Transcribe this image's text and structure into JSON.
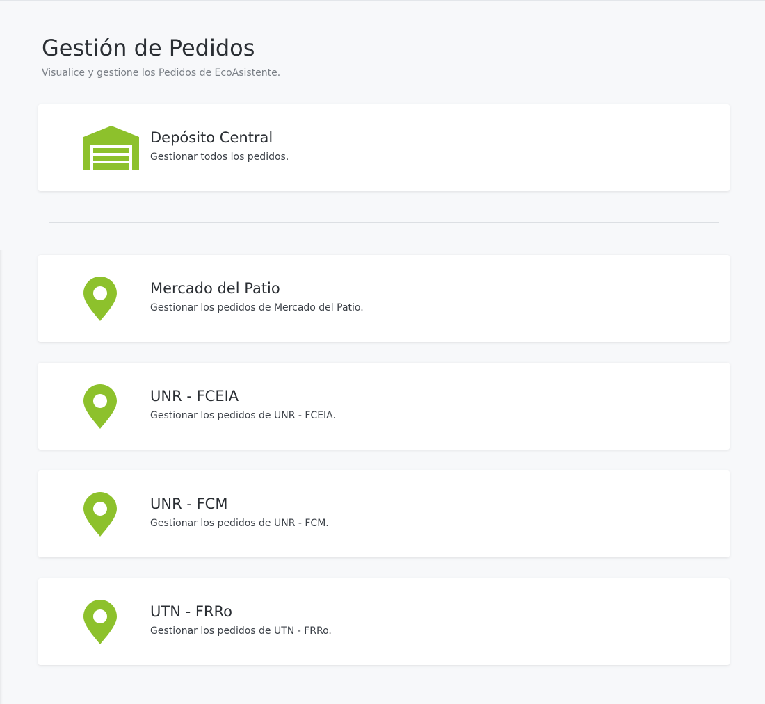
{
  "page": {
    "title": "Gestión de Pedidos",
    "subtitle": "Visualice y gestione los Pedidos de EcoAsistente."
  },
  "colors": {
    "accent": "#8dc12c",
    "background": "#f7f8fa",
    "card": "#ffffff"
  },
  "central": {
    "icon": "warehouse-icon",
    "title": "Depósito Central",
    "description": "Gestionar todos los pedidos."
  },
  "locations": [
    {
      "icon": "map-marker-icon",
      "title": "Mercado del Patio",
      "description": "Gestionar los pedidos de Mercado del Patio."
    },
    {
      "icon": "map-marker-icon",
      "title": "UNR - FCEIA",
      "description": "Gestionar los pedidos de UNR - FCEIA."
    },
    {
      "icon": "map-marker-icon",
      "title": "UNR - FCM",
      "description": "Gestionar los pedidos de UNR - FCM."
    },
    {
      "icon": "map-marker-icon",
      "title": "UTN - FRRo",
      "description": "Gestionar los pedidos de UTN - FRRo."
    }
  ]
}
